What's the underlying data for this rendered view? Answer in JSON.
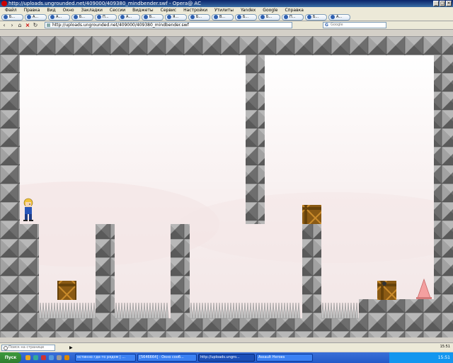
{
  "window": {
    "title": "http://uploads.ungrounded.net/409000/409380_mindbender.swf - Opera@ AC",
    "minimize": "_",
    "maximize": "□",
    "close": "×"
  },
  "menu": [
    "Файл",
    "Правка",
    "Вид",
    "Окно",
    "Закладки",
    "Сессии",
    "Виджеты",
    "Сервис",
    "Настройки",
    "Утилиты",
    "Yandex",
    "Google",
    "Справка"
  ],
  "tabs": [
    {
      "label": "Б..."
    },
    {
      "label": "А..."
    },
    {
      "label": "А..."
    },
    {
      "label": "Б..."
    },
    {
      "label": "П..."
    },
    {
      "label": "А..."
    },
    {
      "label": "Б..."
    },
    {
      "label": "Я..."
    },
    {
      "label": "Б..."
    },
    {
      "label": "В..."
    },
    {
      "label": "Б..."
    },
    {
      "label": "Б..."
    },
    {
      "label": "П..."
    },
    {
      "label": "Б..."
    },
    {
      "label": "А..."
    }
  ],
  "address": {
    "url": "http://uploads.ungrounded.net/409000/409380_mindbender.swf",
    "search_placeholder": "Google"
  },
  "game": {
    "sky_color": "#fbf4f4",
    "block_color": "#8c8c8c",
    "crate_color": "#8a5a14",
    "spike_color": "#bdbdbd",
    "player": "blonde-kid-in-blue",
    "crates": 3,
    "exit_cone": "pink-cone",
    "spike_pits": 4
  },
  "status": {
    "find_placeholder": "Поиск на странице",
    "time": "15:51"
  },
  "taskbar": {
    "start_label": "Пуск",
    "tasks": [
      {
        "label": "нстинно где-то рядом | ..."
      },
      {
        "label": "[5646664] - Окно сооб..."
      },
      {
        "label": "http://uploads.ungro...",
        "active": true
      },
      {
        "label": "Assault Heroes"
      }
    ],
    "clock": "15:51"
  }
}
